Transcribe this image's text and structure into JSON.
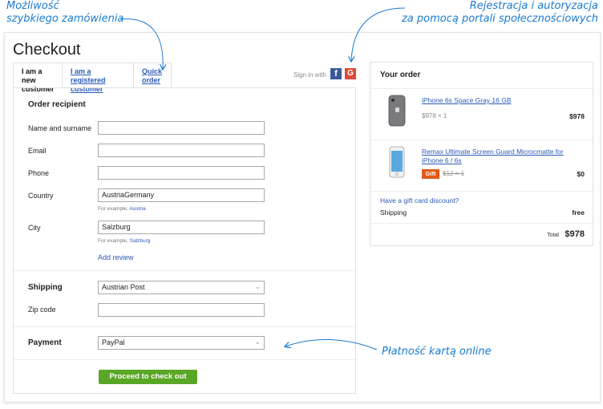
{
  "annotations": {
    "quick_order_line1": "Możliwość",
    "quick_order_line2": "szybkiego zamówienia",
    "social_line1": "Rejestracja i autoryzacja",
    "social_line2": "za pomocą portali społecznościowych",
    "payment_note": "Płatność kartą online"
  },
  "checkout": {
    "title": "Checkout",
    "tabs": [
      {
        "line1": "I am a new",
        "line2": "customer"
      },
      {
        "line1": "I am a registered",
        "line2": "customer"
      },
      {
        "line1": "Quick",
        "line2": "order"
      }
    ],
    "sign_in_with": "Sign in with",
    "facebook_glyph": "f",
    "google_glyph": "G"
  },
  "form": {
    "recipient_title": "Order recipient",
    "name_label": "Name and surname",
    "name_value": "",
    "email_label": "Email",
    "email_value": "",
    "phone_label": "Phone",
    "phone_value": "",
    "country_label": "Country",
    "country_value": "AustriaGermany",
    "country_hint_prefix": "For example,",
    "country_hint_link": "Austria",
    "city_label": "City",
    "city_value": "Salzburg",
    "city_hint_prefix": "For example,",
    "city_hint_link": "Salzburg",
    "add_review": "Add review",
    "shipping_title": "Shipping",
    "shipping_value": "Austrian Post",
    "zip_label": "Zip code",
    "zip_value": "",
    "payment_title": "Payment",
    "payment_value": "PayPal",
    "proceed_label": "Proceed to check out"
  },
  "order": {
    "title": "Your order",
    "items": [
      {
        "name": "iPhone 6s Space Gray 16 GB",
        "qty_price": "$978 × 1",
        "price": "$978"
      },
      {
        "name": "Remax Ultimate Screen Guard Microcmatte for iPhone 6 / 6s",
        "badge": "Gift",
        "qty_price": "$12 × 1",
        "price": "$0"
      }
    ],
    "gift_card": "Have a gift card discount?",
    "shipping_label": "Shipping",
    "shipping_value": "free",
    "total_label": "Total",
    "total_value": "$978"
  },
  "colors": {
    "accent_blue": "#1a7bd0",
    "link_blue": "#2a5ab8",
    "button_green": "#5aa626",
    "gift_orange": "#e05a15",
    "facebook": "#3b5998",
    "google": "#dd4b39"
  }
}
